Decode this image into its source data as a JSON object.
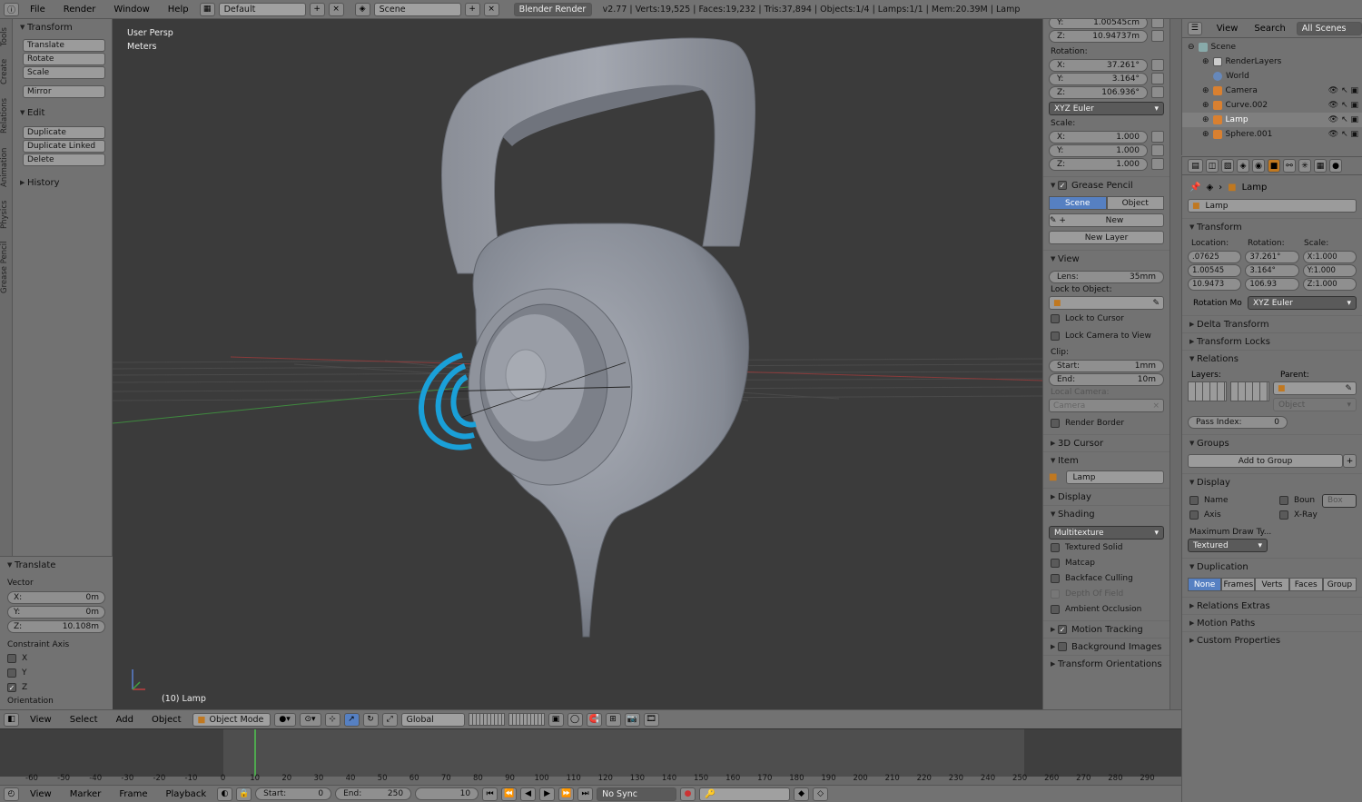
{
  "topbar": {
    "menus": [
      "File",
      "Render",
      "Window",
      "Help"
    ],
    "layout": "Default",
    "scene": "Scene",
    "engine": "Blender Render",
    "stats": "v2.77 | Verts:19,525 | Faces:19,232 | Tris:37,894 | Objects:1/4 | Lamps:1/1 | Mem:20.39M | Lamp"
  },
  "vtabs": [
    "Tools",
    "Create",
    "Relations",
    "Animation",
    "Physics",
    "Grease Pencil"
  ],
  "toolshelf": {
    "transform_h": "Transform",
    "translate": "Translate",
    "rotate": "Rotate",
    "scale": "Scale",
    "mirror": "Mirror",
    "edit_h": "Edit",
    "duplicate": "Duplicate",
    "duplicate_linked": "Duplicate Linked",
    "delete": "Delete",
    "history_h": "History"
  },
  "redo": {
    "title": "Translate",
    "vector": "Vector",
    "x_l": "X:",
    "x_v": "0m",
    "y_l": "Y:",
    "y_v": "0m",
    "z_l": "Z:",
    "z_v": "10.108m",
    "constraint": "Constraint Axis",
    "cx": "X",
    "cy": "Y",
    "cz": "Z",
    "orient": "Orientation"
  },
  "viewport": {
    "persp": "User Persp",
    "units": "Meters",
    "object": "(10) Lamp"
  },
  "npanel": {
    "loc_y_l": "Y:",
    "loc_y_v": "1.00545cm",
    "loc_z_l": "Z:",
    "loc_z_v": "10.94737m",
    "rotation": "Rotation:",
    "rx_l": "X:",
    "rx_v": "37.261°",
    "ry_l": "Y:",
    "ry_v": "3.164°",
    "rz_l": "Z:",
    "rz_v": "106.936°",
    "rot_mode": "XYZ Euler",
    "scale": "Scale:",
    "sx_l": "X:",
    "sx_v": "1.000",
    "sy_l": "Y:",
    "sy_v": "1.000",
    "sz_l": "Z:",
    "sz_v": "1.000",
    "gp_h": "Grease Pencil",
    "gp_scene": "Scene",
    "gp_object": "Object",
    "gp_new": "New",
    "gp_newlayer": "New Layer",
    "view_h": "View",
    "lens_l": "Lens:",
    "lens_v": "35mm",
    "lock_obj": "Lock to Object:",
    "lock_cursor": "Lock to Cursor",
    "lock_cam": "Lock Camera to View",
    "clip": "Clip:",
    "start_l": "Start:",
    "start_v": "1mm",
    "end_l": "End:",
    "end_v": "10m",
    "local_cam": "Local Camera:",
    "camera": "Camera",
    "render_border": "Render Border",
    "cursor_h": "3D Cursor",
    "item_h": "Item",
    "item_name": "Lamp",
    "display_h": "Display",
    "shading_h": "Shading",
    "shading_mode": "Multitexture",
    "textured_solid": "Textured Solid",
    "matcap": "Matcap",
    "backface": "Backface Culling",
    "dof": "Depth Of Field",
    "ao": "Ambient Occlusion",
    "motion_h": "Motion Tracking",
    "bg_h": "Background Images",
    "torient_h": "Transform Orientations"
  },
  "outliner": {
    "view": "View",
    "search": "Search",
    "filter": "All Scenes",
    "items": [
      "Scene",
      "RenderLayers",
      "World",
      "Camera",
      "Curve.002",
      "Lamp",
      "Sphere.001"
    ]
  },
  "props": {
    "crumb": "Lamp",
    "name": "Lamp",
    "transform_h": "Transform",
    "location": "Location:",
    "rotation": "Rotation:",
    "scale": "Scale:",
    "loc": [
      ".07625",
      "1.00545",
      "10.9473"
    ],
    "rot": [
      "37.261°",
      "3.164°",
      "106.93"
    ],
    "scl": [
      "X:1.000",
      "Y:1.000",
      "Z:1.000"
    ],
    "rot_mode_l": "Rotation Mo",
    "rot_mode": "XYZ Euler",
    "delta_h": "Delta Transform",
    "locks_h": "Transform Locks",
    "relations_h": "Relations",
    "layers": "Layers:",
    "parent": "Parent:",
    "parent_type": "Object",
    "pass_l": "Pass Index:",
    "pass_v": "0",
    "groups_h": "Groups",
    "add_group": "Add to Group",
    "display_h": "Display",
    "name_c": "Name",
    "axis_c": "Axis",
    "bound_c": "Boun",
    "bound_v": "Box",
    "xray_c": "X-Ray",
    "max_draw": "Maximum Draw Ty...",
    "max_draw_v": "Textured",
    "dup_h": "Duplication",
    "dup": [
      "None",
      "Frames",
      "Verts",
      "Faces",
      "Group"
    ],
    "rel_extras_h": "Relations Extras",
    "motion_paths_h": "Motion Paths",
    "custom_h": "Custom Properties"
  },
  "vpheader": {
    "menus": [
      "View",
      "Select",
      "Add",
      "Object"
    ],
    "mode": "Object Mode",
    "orient": "Global"
  },
  "timeline": {
    "ticks": [
      "-60",
      "-50",
      "-40",
      "-30",
      "-20",
      "-10",
      "0",
      "10",
      "20",
      "30",
      "40",
      "50",
      "60",
      "70",
      "80",
      "90",
      "100",
      "110",
      "120",
      "130",
      "140",
      "150",
      "160",
      "170",
      "180",
      "190",
      "200",
      "210",
      "220",
      "230",
      "240",
      "250",
      "260",
      "270",
      "280",
      "290"
    ],
    "menus": [
      "View",
      "Marker",
      "Frame",
      "Playback"
    ],
    "start_l": "Start:",
    "start_v": "0",
    "end_l": "End:",
    "end_v": "250",
    "current": "10",
    "sync": "No Sync"
  },
  "colors": {
    "accent": "#5680c2",
    "viewport": "#3b3b3b",
    "panel": "#727272",
    "lamp": "#1aa0d8"
  }
}
